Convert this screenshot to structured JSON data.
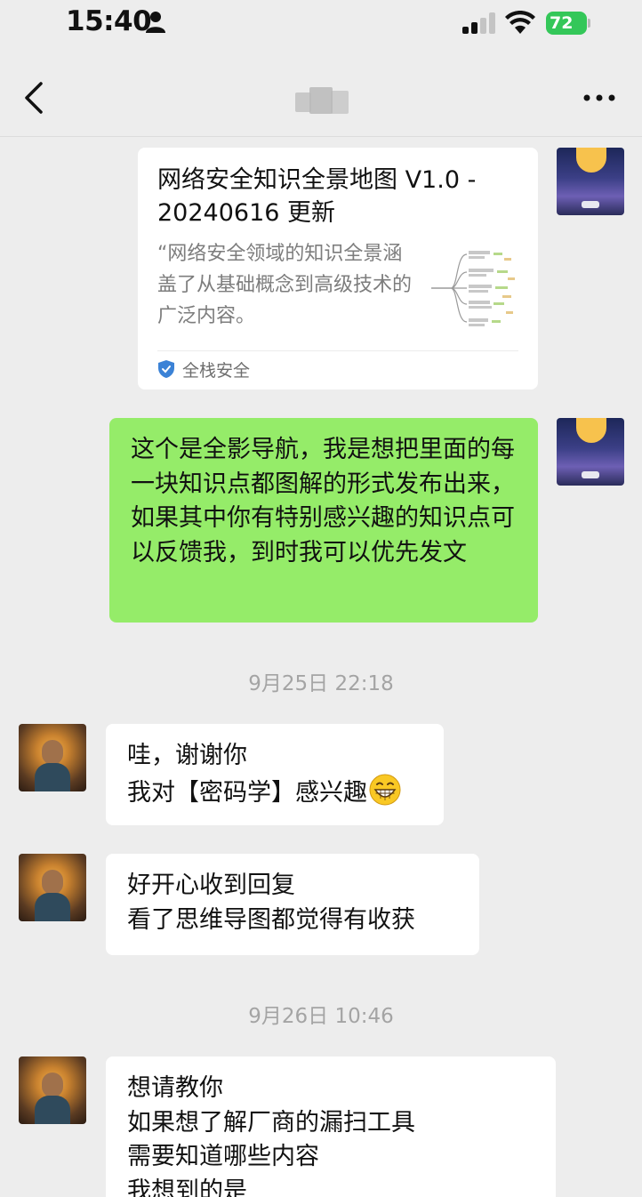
{
  "status_bar": {
    "time": "15:40",
    "battery": "72",
    "icons": [
      "person-icon",
      "signal-icon",
      "wifi-icon",
      "battery-icon"
    ],
    "battery_color": "#34c759"
  },
  "nav": {
    "back_icon": "chevron-left-icon",
    "more_icon": "more-dots-icon"
  },
  "messages": {
    "card": {
      "title": "网络安全知识全景地图 V1.0 - 20240616 更新",
      "description": "“网络安全领域的知识全景涵盖了从基础概念到高级技术的广泛内容。",
      "source": "全栈安全"
    },
    "self_text": "这个是全影导航，我是想把里面的每一块知识点都图解的形式发布出来，如果其中你有特别感兴趣的知识点可以反馈我，到时我可以优先发文",
    "timestamp_1": "9月25日 22:18",
    "reply_1_line1": "哇，谢谢你",
    "reply_1_line2": "我对【密码学】感兴趣",
    "reply_2": "好开心收到回复\n看了思维导图都觉得有收获",
    "timestamp_2": "9月26日 10:46",
    "reply_3": "想请教你\n如果想了解厂商的漏扫工具\n需要知道哪些内容\n我想到的是"
  },
  "colors": {
    "background": "#ededed",
    "self_bubble": "#95ec69",
    "other_bubble": "#ffffff"
  }
}
